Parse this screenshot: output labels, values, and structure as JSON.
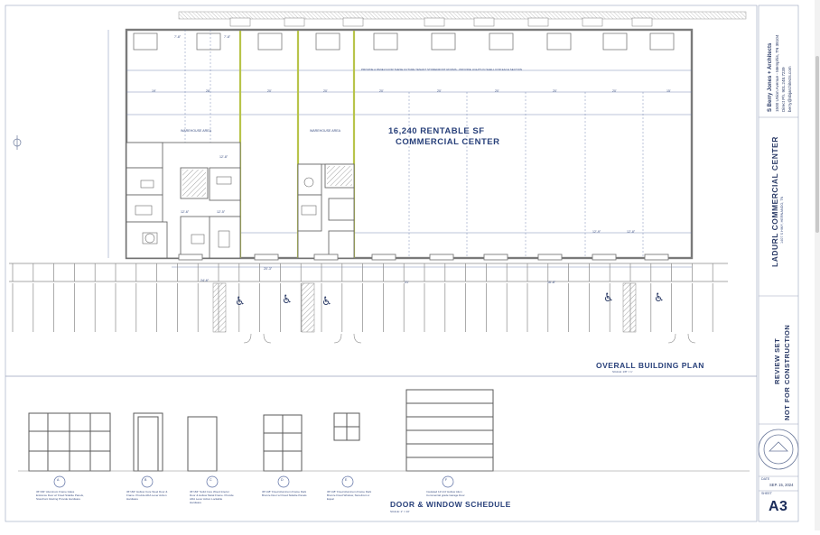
{
  "plan": {
    "center_line1": "16,240 RENTABLE SF",
    "center_line2": "COMMERCIAL CENTER",
    "title": "OVERALL BUILDING PLAN",
    "scale": "SCALE: 1/8\" = 1'",
    "warehouse_label": "WAREHOUSE AREA",
    "note_top": "PROVIDE A PANELS FOR THESE FUTURE TENANT STOREFRONT ROOMS - PROVIDE LIGHTS IN SHELL FOR EACH SECTION",
    "dims": [
      "7'-8\"",
      "7'-8\"",
      "19'",
      "28'",
      "20'",
      "20'",
      "20'",
      "20'",
      "20'",
      "20'",
      "20'",
      "15'",
      "12'-8\"",
      "12'-6\"",
      "12'-5\"",
      "24'-6\"",
      "20'-3\"",
      "16'-8\"",
      "21'",
      "12'-9\"",
      "12'-8\""
    ]
  },
  "schedule": {
    "title": "DOOR & WINDOW SCHEDULE",
    "scale": "SCALE: 1\" = 10'",
    "items": [
      {
        "mark": "A",
        "note": "36\"x84\" Aluminum Frame Glass Entrance Door w/ Fixed Sidelite Panels, Storefront Glazing Provide Hardware"
      },
      {
        "mark": "B",
        "note": "36\"x84\" Hollow Core Steel Door & Frame. Provide ADA Lever Action Hardware"
      },
      {
        "mark": "C",
        "note": "36\"x84\" Solid Core Wood Interior Door & Hollow Metal Frame. Provide ADA Lever Action Lockable Hardware"
      },
      {
        "mark": "D",
        "note": "36\"x48\" Fixed Aluminum Frame Dark Bronze Door w/ Fixed Sidelite Panels"
      },
      {
        "mark": "E",
        "note": "36\"x48\" Fixed Aluminum Frame Dark Bronze Fixed Window, Storefront or Equal"
      },
      {
        "mark": "F",
        "note": "Insulated 12'x14' Hollow Alum Commercial grade Garage Door"
      }
    ]
  },
  "titleblock": {
    "firm": "S Berry Jones + Architects",
    "address": "1500 Union Avenue - Memphis, TN 38104",
    "phone": "Direct Ph. 901.248.7239",
    "email": "berry@sbjarchitects.com",
    "project": "LADURL COMMERCIAL CENTER",
    "project_sub": "1407 S HWY, HERNANDO, TN",
    "status1": "REVIEW SET",
    "status2": "NOT FOR CONSTRUCTION",
    "date_label": "DATE",
    "date": "SEP. 15, 2024",
    "sheet_label": "SHEET",
    "sheet": "A3"
  },
  "colors": {
    "ink": "#28407a",
    "wall": "#7a7a7a",
    "accent": "#b8c44a",
    "hatch": "#8a8a8a"
  },
  "icons": [
    "accessible-parking-icon",
    "north-arrow-icon",
    "professional-seal-icon"
  ]
}
